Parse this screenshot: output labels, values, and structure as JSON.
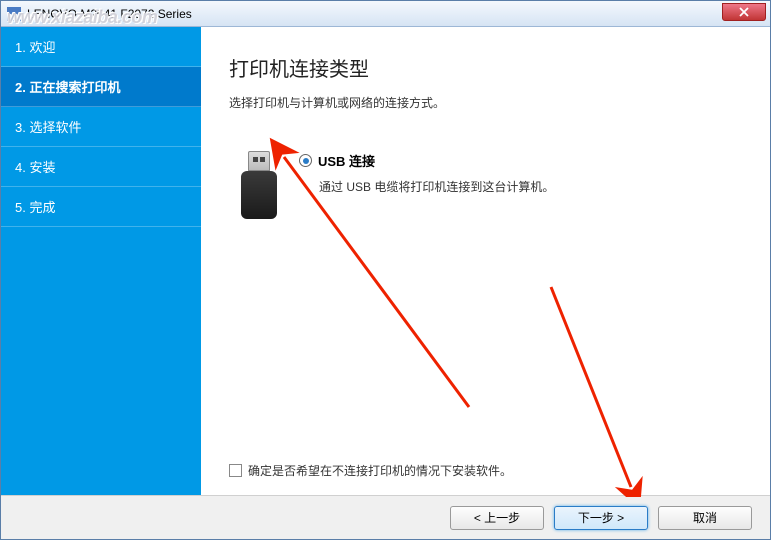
{
  "window": {
    "title": "LENOVO M2041 F2072 Series"
  },
  "sidebar": {
    "items": [
      {
        "label": "1. 欢迎"
      },
      {
        "label": "2. 正在搜索打印机"
      },
      {
        "label": "3. 选择软件"
      },
      {
        "label": "4. 安装"
      },
      {
        "label": "5. 完成"
      }
    ]
  },
  "main": {
    "title": "打印机连接类型",
    "subtitle": "选择打印机与计算机或网络的连接方式。",
    "option": {
      "label": "USB 连接",
      "desc": "通过 USB 电缆将打印机连接到这台计算机。"
    },
    "checkbox_label": "确定是否希望在不连接打印机的情况下安装软件。"
  },
  "footer": {
    "back": "< 上一步",
    "next": "下一步 >",
    "cancel": "取消"
  },
  "watermark": "www.xiazaiba.com"
}
